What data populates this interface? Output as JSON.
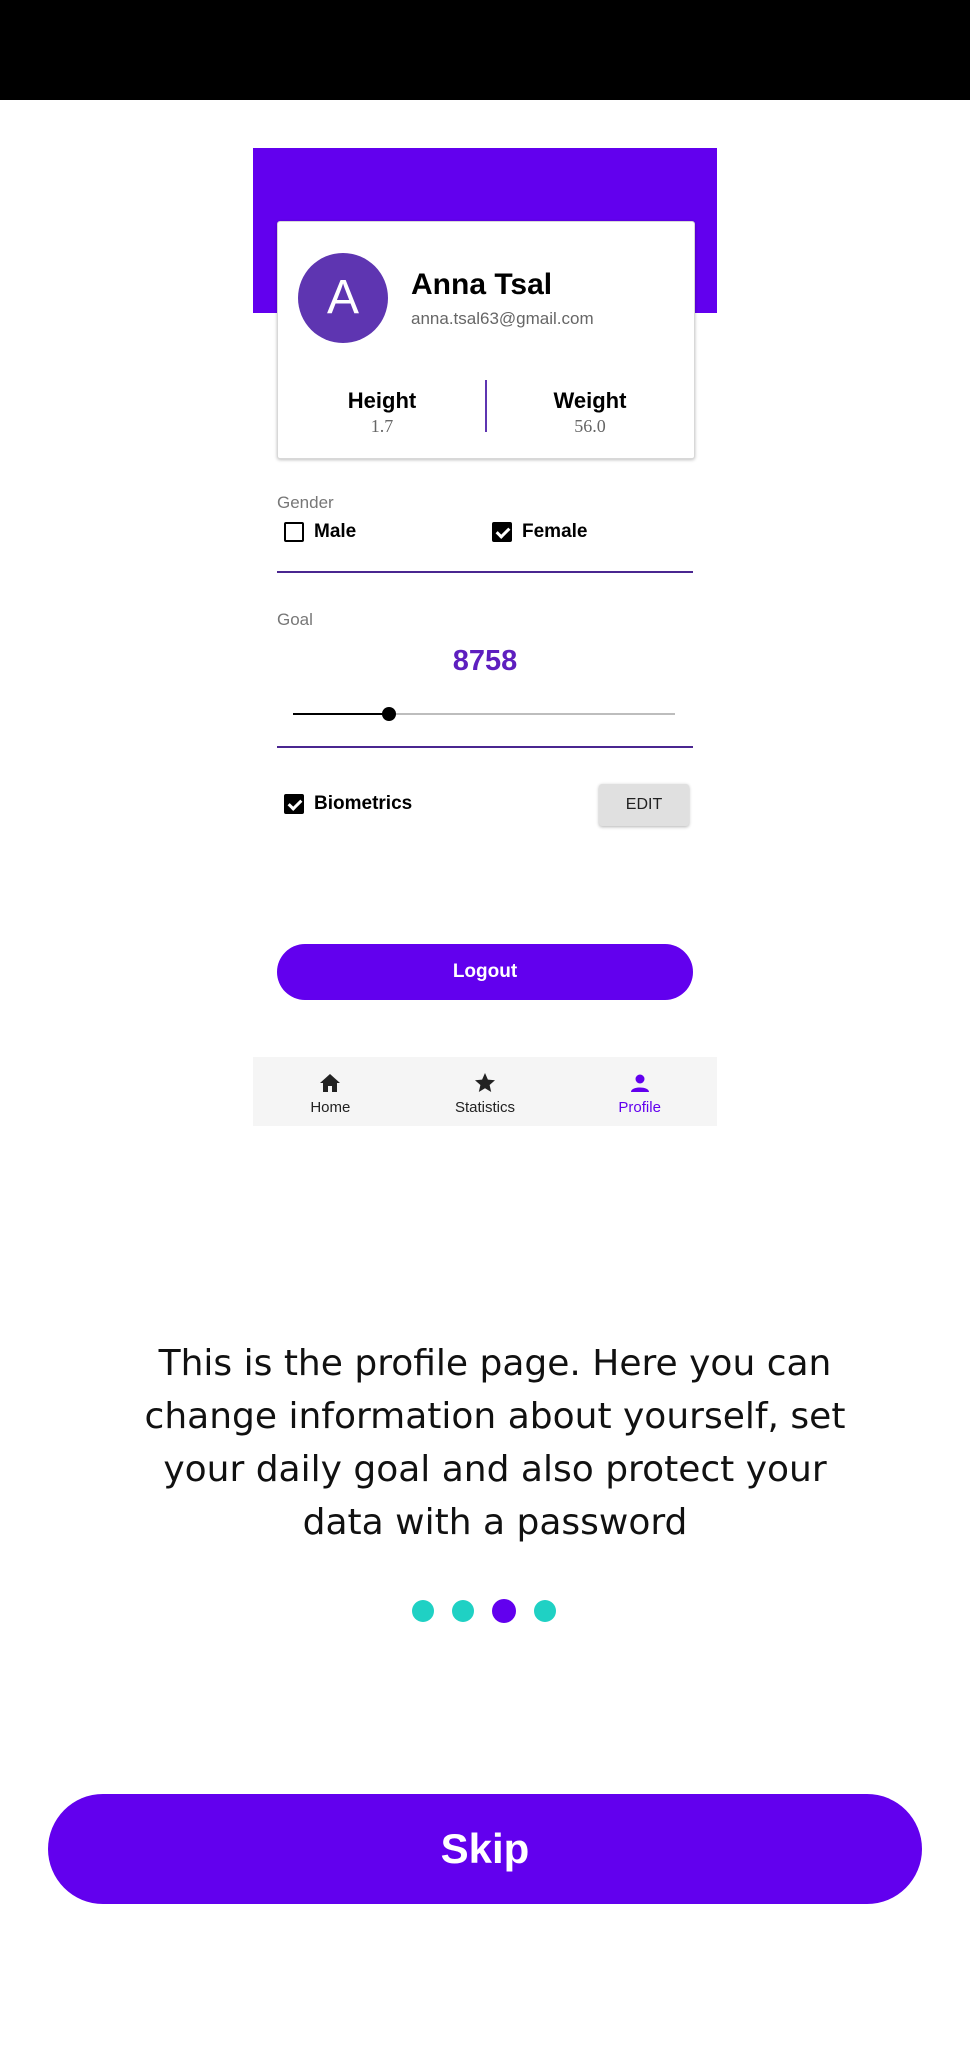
{
  "profile": {
    "avatar_initial": "A",
    "name": "Anna Tsal",
    "email": "anna.tsal63@gmail.com",
    "height_label": "Height",
    "height_value": "1.7",
    "weight_label": "Weight",
    "weight_value": "56.0"
  },
  "gender": {
    "label": "Gender",
    "male_label": "Male",
    "female_label": "Female",
    "male_checked": false,
    "female_checked": true
  },
  "goal": {
    "label": "Goal",
    "value": "8758",
    "slider_fraction": 0.25
  },
  "biometrics": {
    "label": "Biometrics",
    "checked": true,
    "edit_label": "EDIT"
  },
  "logout_label": "Logout",
  "nav": {
    "home": "Home",
    "statistics": "Statistics",
    "profile": "Profile",
    "active": "profile"
  },
  "onboarding": {
    "description": "This is the profile page. Here you can change information about yourself, set your daily goal and also protect your data with a password",
    "page_count": 4,
    "active_page": 3,
    "skip_label": "Skip"
  },
  "colors": {
    "primary": "#6200ee",
    "avatar": "#5e35b1",
    "dot_inactive": "#1fd1c4",
    "goal_text": "#5e1fbf"
  }
}
